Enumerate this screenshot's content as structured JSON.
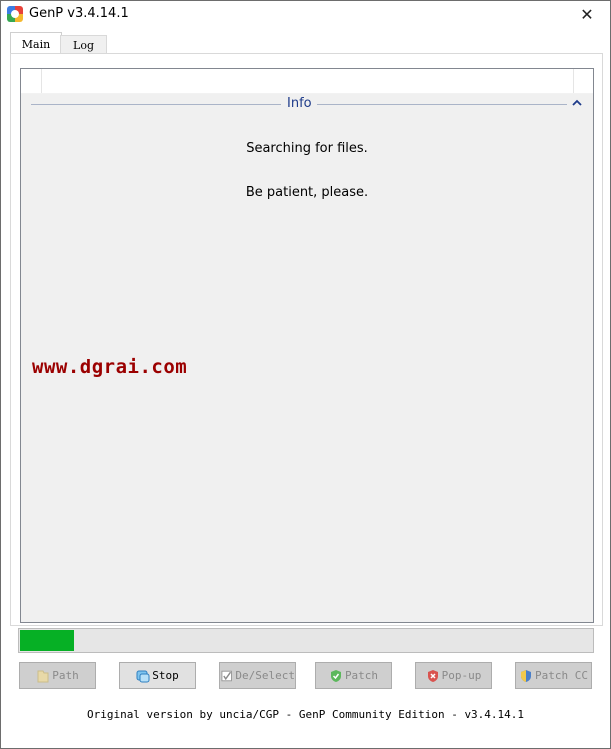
{
  "window": {
    "title": "GenP v3.4.14.1",
    "close_glyph": "✕"
  },
  "tabs": [
    {
      "label": "Main",
      "selected": true
    },
    {
      "label": "Log",
      "selected": false
    }
  ],
  "info": {
    "group_title": "Info",
    "messages": [
      "Searching for files.",
      "Be patient, please."
    ],
    "watermark": "www.dgrai.com"
  },
  "progress": {
    "fraction": 0.095,
    "color": "#06b025"
  },
  "buttons": [
    {
      "label": "Path",
      "enabled": false,
      "icon": "folder-icon"
    },
    {
      "label": "Stop",
      "enabled": true,
      "icon": "stop-icon"
    },
    {
      "label": "De/Select",
      "enabled": false,
      "icon": "checkbox-icon"
    },
    {
      "label": "Patch",
      "enabled": false,
      "icon": "shield-check-icon"
    },
    {
      "label": "Pop-up",
      "enabled": false,
      "icon": "shield-x-icon"
    },
    {
      "label": "Patch CC",
      "enabled": false,
      "icon": "shield-icon"
    }
  ],
  "footer": {
    "text": "Original version by uncia/CGP - GenP Community Edition - v3.4.14.1"
  }
}
